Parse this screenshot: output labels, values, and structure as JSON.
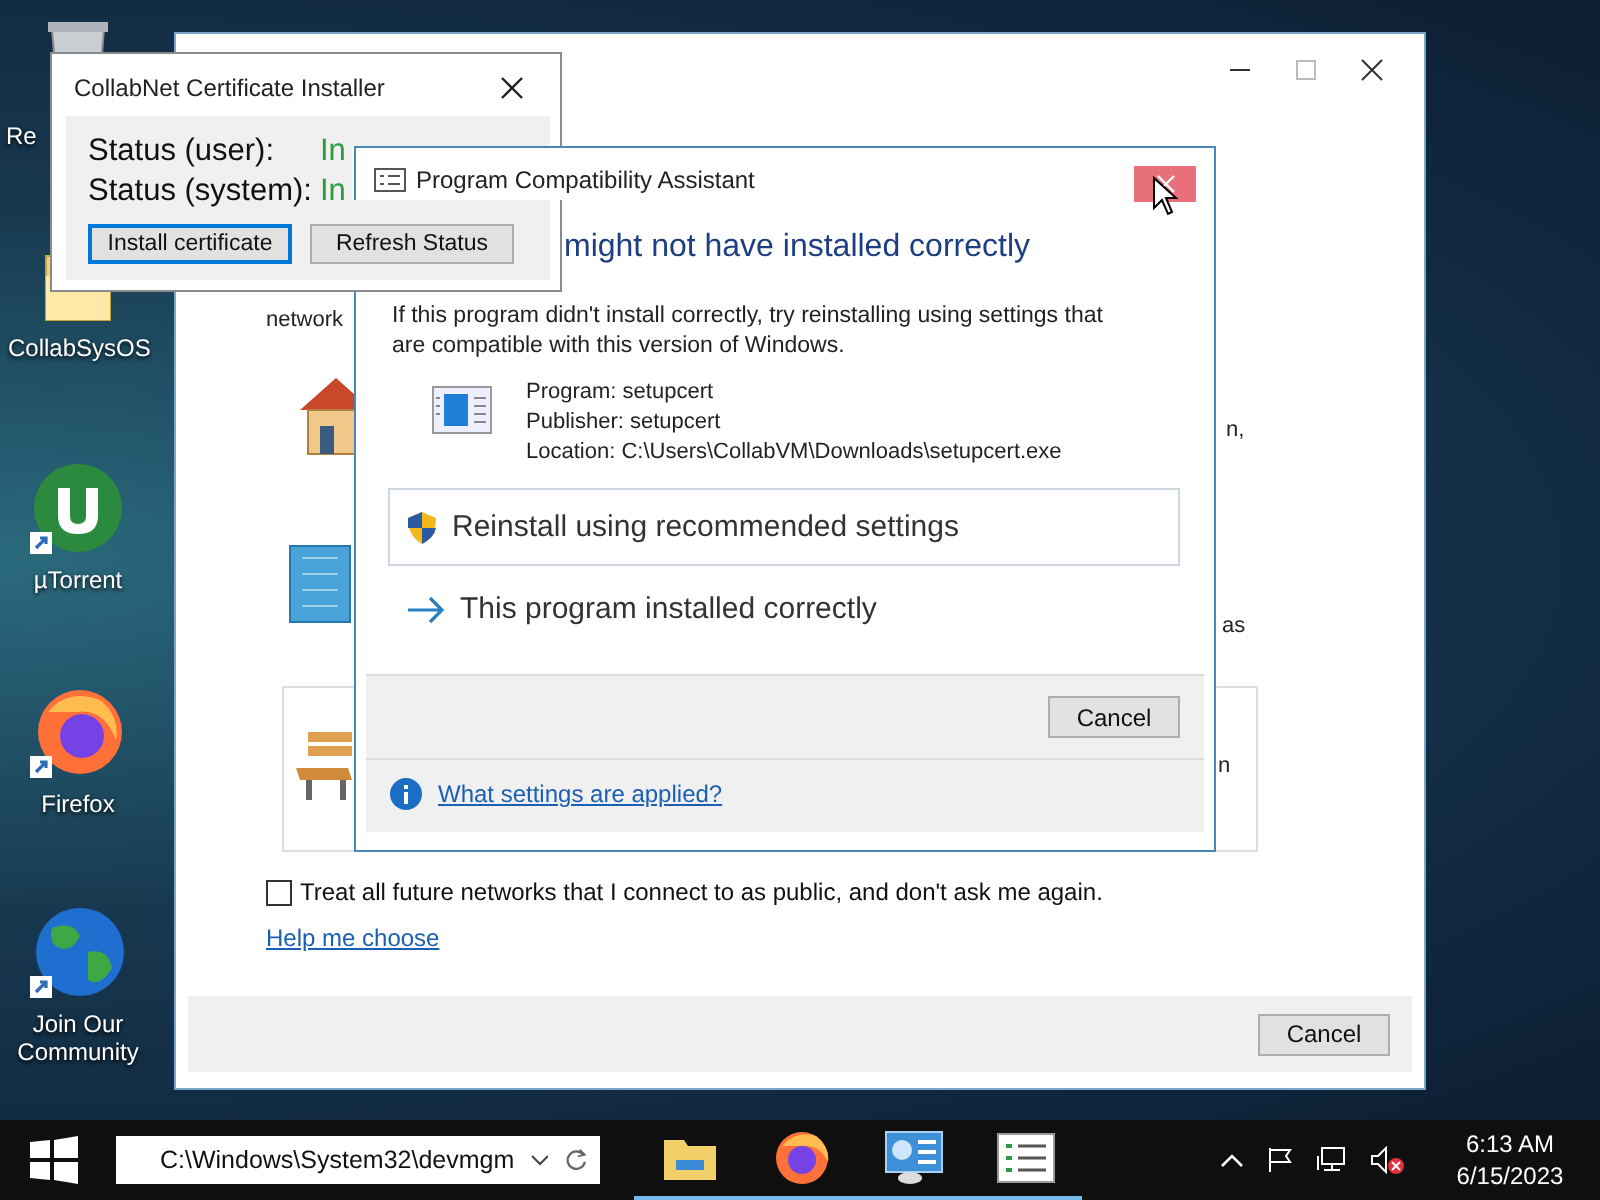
{
  "desktop_icons": [
    {
      "label": "Re",
      "kind": "recycle"
    },
    {
      "label": "CollabSysOS",
      "kind": "folder"
    },
    {
      "label": "µTorrent",
      "kind": "torrent"
    },
    {
      "label": "Firefox",
      "kind": "firefox"
    },
    {
      "label": "Join Our Community",
      "kind": "globe"
    }
  ],
  "network_window": {
    "fragments": [
      {
        "text": "network",
        "kind": "intro"
      },
      {
        "text": "n,",
        "kind": "home"
      },
      {
        "text": "as",
        "kind": "work"
      },
      {
        "text": "n",
        "kind": "public"
      }
    ],
    "checkbox": {
      "label": "Treat all future networks that I connect to as public, and don't ask me again.",
      "checked": false
    },
    "link": "Help me choose",
    "cancel": "Cancel"
  },
  "compat_window": {
    "title": "Program Compatibility Assistant",
    "headline": "might not have installed correctly",
    "message": "If this program didn't install correctly, try reinstalling using settings that are compatible with this version of Windows.",
    "details": [
      "Program: setupcert",
      "Publisher: setupcert",
      "Location: C:\\Users\\CollabVM\\Downloads\\setupcert.exe"
    ],
    "options": [
      {
        "label": "Reinstall using recommended settings",
        "kind": "shield",
        "selected": true
      },
      {
        "label": "This program installed correctly",
        "kind": "arrow",
        "selected": false
      }
    ],
    "cancel": "Cancel",
    "help_link": "What settings are applied?"
  },
  "cert_window": {
    "title": "CollabNet Certificate Installer",
    "rows": [
      {
        "label": "Status (user):",
        "value": "In"
      },
      {
        "label": "Status (system):",
        "value": "In"
      }
    ],
    "buttons": [
      {
        "label": "Install certificate",
        "focused": true
      },
      {
        "label": "Refresh Status",
        "focused": false
      }
    ]
  },
  "taskbar": {
    "address": "C:\\Windows\\System32\\devmgm",
    "apps": [
      {
        "kind": "folder"
      },
      {
        "kind": "firefox"
      },
      {
        "kind": "control-panel"
      },
      {
        "kind": "list"
      }
    ],
    "time": "6:13 AM",
    "date": "6/15/2023"
  }
}
